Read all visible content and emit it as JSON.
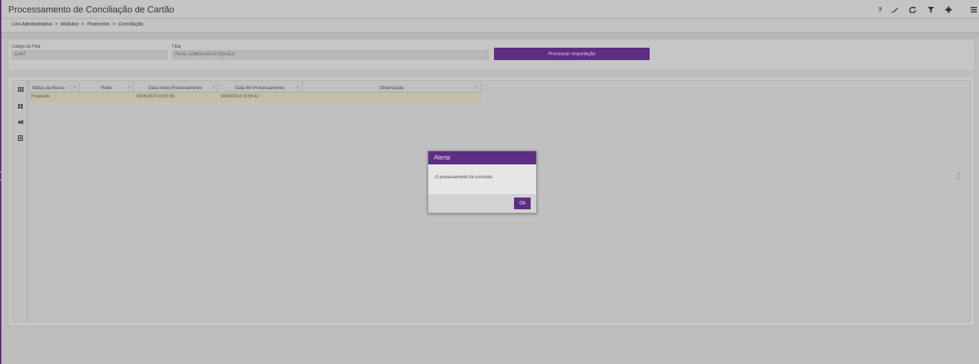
{
  "header": {
    "title": "Processamento de Conciliação de Cartão",
    "icons": [
      "help-icon",
      "eraser-icon",
      "refresh-icon",
      "filter-icon",
      "gear-icon",
      "menu-icon"
    ],
    "help_glyph": "?"
  },
  "breadcrumb": {
    "items": [
      "Linx Administrativo",
      "Módulos",
      "Financeiro",
      "Conciliação"
    ],
    "separator": ">"
  },
  "filters": {
    "codigo_label": "Código da Filial",
    "codigo_value": "11407",
    "filial_label": "Filial",
    "filial_value": "FILIAL CONCILIACAO EQUALS",
    "process_button": "Processar Importação"
  },
  "grid": {
    "columns": [
      "Status da Busca",
      "Rede",
      "Data início Processamento",
      "Data fim Processamento",
      "Observação"
    ],
    "rows": [
      {
        "status": "Finalizado",
        "rede": "",
        "inicio": "30/06/2023 15:50:35",
        "fim": "30/06/2023 15:50:42",
        "obs": ""
      }
    ],
    "side_icons": [
      "grid-icon",
      "layout-icon",
      "group-icon",
      "export-icon"
    ]
  },
  "modal": {
    "title": "Alerta",
    "message": "O processamento foi concluído",
    "ok_label": "Ok"
  },
  "colors": {
    "accent": "#5c2d82",
    "row_highlight": "#c4bda7"
  }
}
